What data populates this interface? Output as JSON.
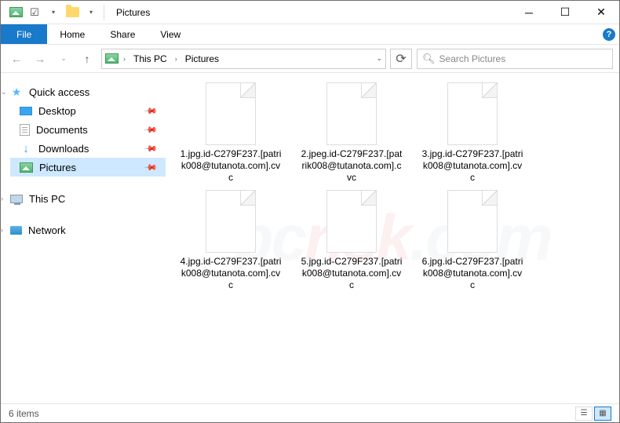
{
  "window": {
    "title": "Pictures"
  },
  "ribbon": {
    "file": "File",
    "tabs": [
      "Home",
      "Share",
      "View"
    ]
  },
  "address": {
    "crumbs": [
      "This PC",
      "Pictures"
    ],
    "search_placeholder": "Search Pictures"
  },
  "nav": {
    "quick_access": "Quick access",
    "items": [
      {
        "label": "Desktop",
        "pinned": true
      },
      {
        "label": "Documents",
        "pinned": true
      },
      {
        "label": "Downloads",
        "pinned": true
      },
      {
        "label": "Pictures",
        "pinned": true,
        "selected": true
      }
    ],
    "this_pc": "This PC",
    "network": "Network"
  },
  "files": [
    {
      "name": "1.jpg.id-C279F237.[patrik008@tutanota.com].cvc"
    },
    {
      "name": "2.jpeg.id-C279F237.[patrik008@tutanota.com].cvc"
    },
    {
      "name": "3.jpg.id-C279F237.[patrik008@tutanota.com].cvc"
    },
    {
      "name": "4.jpg.id-C279F237.[patrik008@tutanota.com].cvc"
    },
    {
      "name": "5.jpg.id-C279F237.[patrik008@tutanota.com].cvc"
    },
    {
      "name": "6.jpg.id-C279F237.[patrik008@tutanota.com].cvc"
    }
  ],
  "status": {
    "count_label": "6 items"
  },
  "watermark": {
    "a": "pc",
    "b": "risk",
    "c": ".com"
  }
}
